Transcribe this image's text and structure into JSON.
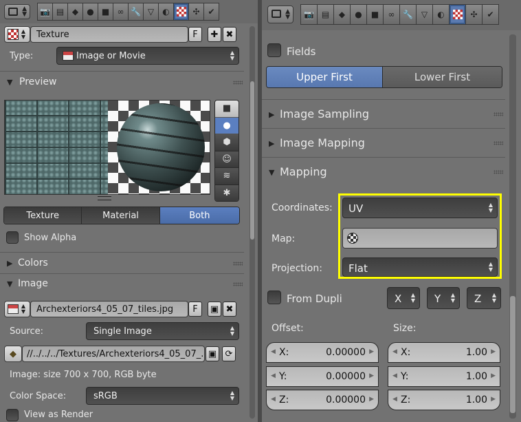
{
  "left": {
    "texture_name": "Texture",
    "fake_user": "F",
    "type_label": "Type:",
    "type_value": "Image or Movie",
    "preview": {
      "title": "Preview",
      "toggle": [
        "Texture",
        "Material",
        "Both"
      ],
      "toggle_selected": "Both",
      "show_alpha": "Show Alpha"
    },
    "colors_title": "Colors",
    "image": {
      "title": "Image",
      "file_name": "Archexteriors4_05_07_tiles.jpg",
      "fake_user": "F",
      "source_label": "Source:",
      "source_value": "Single Image",
      "path": "//../../../Textures/Archexteriors4_05_07_...",
      "info": "Image: size 700 x 700, RGB byte",
      "colorspace_label": "Color Space:",
      "colorspace_value": "sRGB",
      "view_as_render": "View as Render"
    }
  },
  "right": {
    "fields_label": "Fields",
    "field_order": [
      "Upper First",
      "Lower First"
    ],
    "field_order_selected": "Upper First",
    "sections": [
      "Image Sampling",
      "Image Mapping"
    ],
    "mapping": {
      "title": "Mapping",
      "coordinates_label": "Coordinates:",
      "coordinates_value": "UV",
      "map_label": "Map:",
      "map_value": "",
      "projection_label": "Projection:",
      "projection_value": "Flat",
      "from_dupli": "From Dupli",
      "axes": [
        "X",
        "Y",
        "Z"
      ],
      "offset_label": "Offset:",
      "size_label": "Size:",
      "offset": [
        {
          "axis": "X:",
          "value": "0.00000"
        },
        {
          "axis": "Y:",
          "value": "0.00000"
        },
        {
          "axis": "Z:",
          "value": "0.00000"
        }
      ],
      "size": [
        {
          "axis": "X:",
          "value": "1.00"
        },
        {
          "axis": "Y:",
          "value": "1.00"
        },
        {
          "axis": "Z:",
          "value": "1.00"
        }
      ]
    },
    "highlight_color": "#ffff00"
  },
  "colors": {
    "accent": "#5b7fc0",
    "panel": "#727272"
  }
}
